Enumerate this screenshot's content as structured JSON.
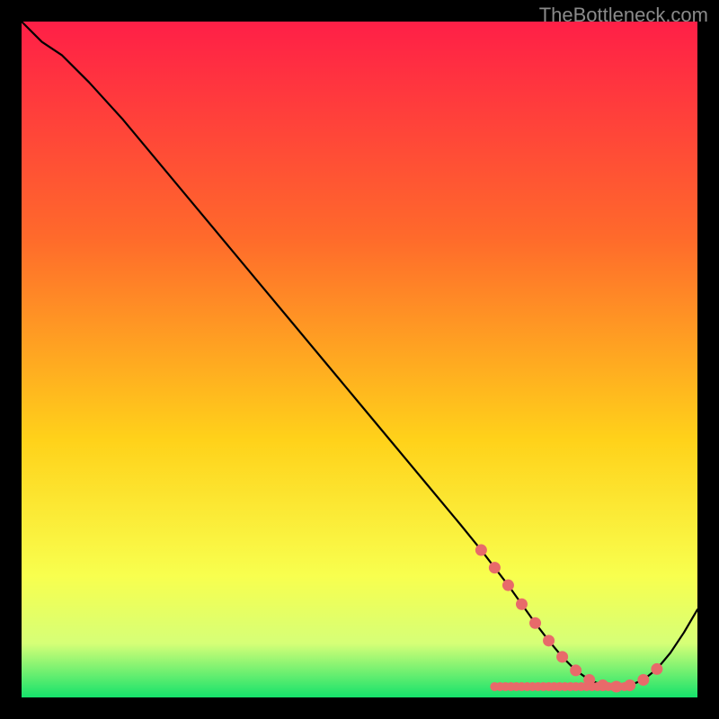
{
  "watermark": "TheBottleneck.com",
  "colors": {
    "grad_top": "#ff1f47",
    "grad_mid1": "#ff6a2b",
    "grad_mid2": "#ffd21a",
    "grad_mid3": "#f8ff4e",
    "grad_mid4": "#d6ff77",
    "grad_bottom": "#15e26b",
    "curve": "#000000",
    "marker_fill": "#e86a6a",
    "marker_stroke": "#c94f4f"
  },
  "chart_data": {
    "type": "line",
    "title": "",
    "xlabel": "",
    "ylabel": "",
    "xlim": [
      0,
      100
    ],
    "ylim": [
      0,
      100
    ],
    "x": [
      0,
      3,
      6,
      10,
      15,
      20,
      25,
      30,
      35,
      40,
      45,
      50,
      55,
      60,
      65,
      68,
      70,
      72,
      74,
      76,
      78,
      80,
      82,
      84,
      86,
      88,
      90,
      92,
      94,
      96,
      98,
      100
    ],
    "y": [
      100,
      97,
      95,
      91,
      85.5,
      79.5,
      73.5,
      67.5,
      61.5,
      55.5,
      49.5,
      43.5,
      37.5,
      31.5,
      25.5,
      21.8,
      19.2,
      16.6,
      13.8,
      11.0,
      8.4,
      6.0,
      4.0,
      2.6,
      1.8,
      1.6,
      1.8,
      2.6,
      4.2,
      6.6,
      9.6,
      13.0
    ],
    "markers": {
      "x": [
        68,
        70,
        72,
        74,
        76,
        78,
        80,
        82,
        84,
        86,
        88,
        90,
        92,
        94
      ],
      "y": [
        21.8,
        19.2,
        16.6,
        13.8,
        11.0,
        8.4,
        6.0,
        4.0,
        2.6,
        1.8,
        1.6,
        1.8,
        2.6,
        4.2
      ]
    },
    "marker_trough": {
      "count": 26,
      "x_start": 70,
      "x_end": 90,
      "y": 1.6
    }
  }
}
